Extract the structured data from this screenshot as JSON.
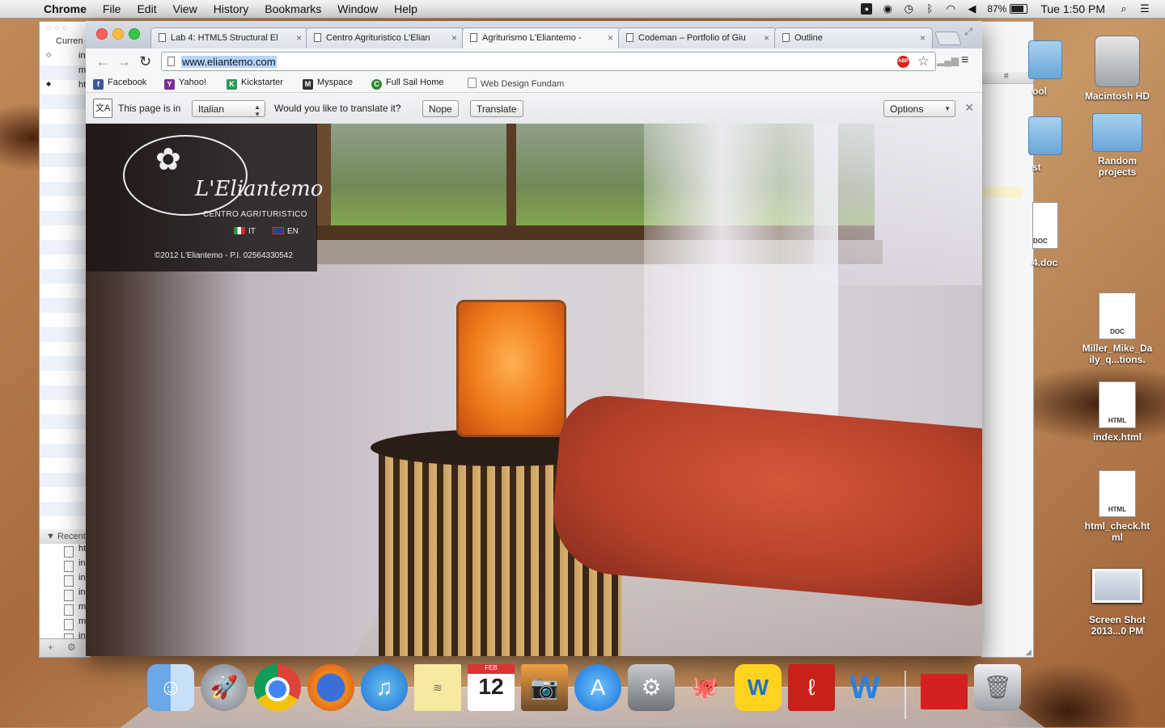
{
  "menubar": {
    "apple": "",
    "items": [
      "Chrome",
      "File",
      "Edit",
      "View",
      "History",
      "Bookmarks",
      "Window",
      "Help"
    ],
    "battery": "87%",
    "clock": "Tue 1:50 PM"
  },
  "bg_left_window": {
    "header": "Curren",
    "rows": [
      "in",
      "m",
      "ht"
    ],
    "recent_label": "Recent",
    "recent_rows": [
      "ht",
      "in",
      "in",
      "in",
      "m",
      "m",
      "in"
    ]
  },
  "bg_right_window": {
    "toolbar_text": "#"
  },
  "tabs": [
    {
      "title": "Lab 4: HTML5 Structural El",
      "active": false
    },
    {
      "title": "Centro Agrituristico L'Elian",
      "active": false
    },
    {
      "title": "Agriturismo L'Eliantemo -",
      "active": true
    },
    {
      "title": "Codeman – Portfolio of Giu",
      "active": false
    },
    {
      "title": "Outline",
      "active": false
    }
  ],
  "omnibox": {
    "url": "www.eliantemo.com",
    "abp_label": "ABP"
  },
  "bookmarks": [
    {
      "label": "Facebook",
      "icon": "facebook-icon",
      "color": "#3b5998",
      "glyph": "f"
    },
    {
      "label": "Yahoo!",
      "icon": "yahoo-icon",
      "color": "#7b2d9a",
      "glyph": "Y"
    },
    {
      "label": "Kickstarter",
      "icon": "kickstarter-icon",
      "color": "#2b9a55",
      "glyph": "K"
    },
    {
      "label": "Myspace",
      "icon": "myspace-icon",
      "color": "#333333",
      "glyph": "M"
    },
    {
      "label": "Full Sail Home",
      "icon": "fullsail-icon",
      "color": "#2f8a2f",
      "glyph": "C"
    },
    {
      "label": "Web Design Fundam",
      "icon": "page-icon",
      "color": "#ffffff",
      "glyph": ""
    }
  ],
  "translate_bar": {
    "prefix": "This page is in",
    "language": "Italian",
    "question": "Would you like to translate it?",
    "nope": "Nope",
    "translate": "Translate",
    "options": "Options"
  },
  "site": {
    "logo_name": "L'Eliantemo",
    "logo_sub": "CENTRO AGRITURISTICO",
    "lang_it": "IT",
    "lang_en": "EN",
    "copyright": "©2012 L'Eliantemo - P.I. 02564330542"
  },
  "desktop_icons": [
    {
      "label": "Macintosh HD",
      "kind": "hd"
    },
    {
      "label": "Random projects",
      "kind": "folder"
    },
    {
      "label": "Miller_Mike_Daily_q...tions.",
      "kind": "doc",
      "badge": "DOC"
    },
    {
      "label": "index.html",
      "kind": "doc",
      "badge": "HTML"
    },
    {
      "label": "html_check.html",
      "kind": "doc",
      "badge": "HTML"
    },
    {
      "label": "Screen Shot 2013...0 PM",
      "kind": "thumb"
    }
  ],
  "desktop_partial_labels": {
    "folder1": "ool",
    "folder2": "st",
    "doc1": "4.doc",
    "doc1_badge": "DOC"
  },
  "dock": {
    "calendar_month": "FEB",
    "calendar_day": "12",
    "items": [
      "finder",
      "launchpad",
      "chrome",
      "firefox",
      "itunes",
      "stickies",
      "calendar",
      "iphoto",
      "app-store",
      "system-preferences",
      "github",
      "wunderlist",
      "acrobat",
      "word",
      "screen-sharing",
      "trash"
    ]
  },
  "colors": {
    "tab_active": "#f6f7f9",
    "url_highlight": "#b5d5ff",
    "close_red": "#fc605c",
    "min_yellow": "#fdbc40",
    "max_green": "#34c84a"
  }
}
